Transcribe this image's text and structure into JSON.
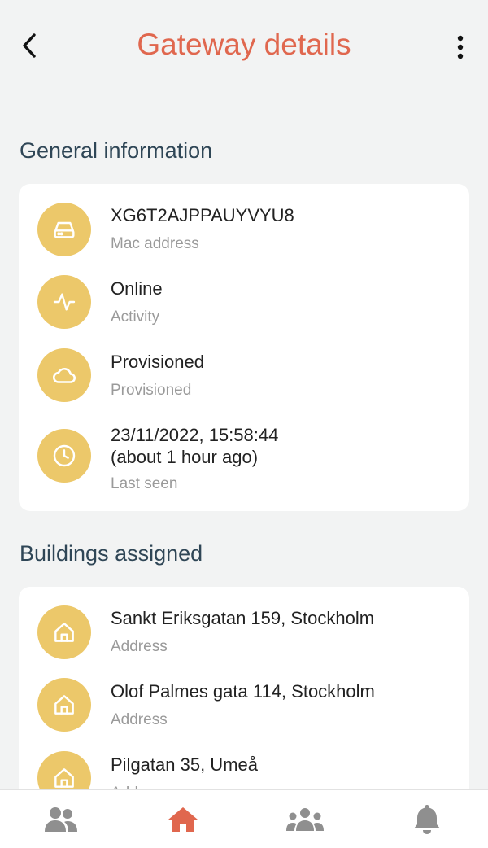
{
  "header": {
    "title": "Gateway details"
  },
  "general": {
    "section_title": "General information",
    "mac": {
      "value": "XG6T2AJPPAUYVYU8",
      "label": "Mac address"
    },
    "activity": {
      "value": "Online",
      "label": "Activity"
    },
    "provisioned": {
      "value": "Provisioned",
      "label": "Provisioned"
    },
    "last_seen": {
      "value": "23/11/2022, 15:58:44",
      "relative": "(about 1 hour ago)",
      "label": "Last seen"
    }
  },
  "buildings": {
    "section_title": "Buildings assigned",
    "items": [
      {
        "address": "Sankt Eriksgatan 159, Stockholm",
        "label": "Address"
      },
      {
        "address": "Olof Palmes gata 114, Stockholm",
        "label": "Address"
      },
      {
        "address": "Pilgatan 35, Umeå",
        "label": "Address"
      }
    ]
  },
  "tabbar": {
    "tabs": [
      {
        "icon": "people-icon",
        "active": false
      },
      {
        "icon": "home-icon",
        "active": true
      },
      {
        "icon": "group-icon",
        "active": false
      },
      {
        "icon": "bell-icon",
        "active": false
      }
    ]
  },
  "colors": {
    "accent": "#e0674e",
    "icon_bg": "#ecc86a",
    "heading": "#2f4656",
    "inactive_icon": "#8f8f8f"
  }
}
